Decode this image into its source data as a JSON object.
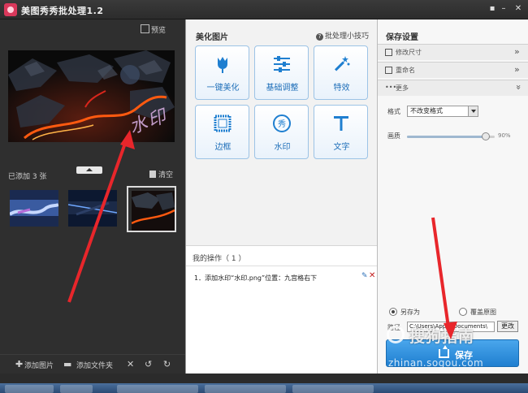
{
  "window": {
    "title": "美图秀秀批处理1.2",
    "menu_icon": "menu-icon",
    "minimize_icon": "minimize-icon",
    "close_icon": "close-icon"
  },
  "left_panel": {
    "preview_label": "预览",
    "watermark_text": "水印",
    "added_text": "已添加 3 张",
    "clear_label": "清空",
    "add_image_label": "添加图片",
    "add_folder_label": "添加文件夹",
    "delete_icon": "x-icon",
    "undo_icon": "undo-icon",
    "redo_icon": "redo-icon"
  },
  "middle_panel": {
    "title": "美化图片",
    "tips_label": "批处理小技巧",
    "tools": [
      {
        "label": "一键美化",
        "icon": "tulip-icon"
      },
      {
        "label": "基础调整",
        "icon": "sliders-icon"
      },
      {
        "label": "特效",
        "icon": "magic-wand-icon"
      },
      {
        "label": "边框",
        "icon": "frame-icon"
      },
      {
        "label": "水印",
        "icon": "watermark-icon"
      },
      {
        "label": "文字",
        "icon": "text-icon"
      }
    ],
    "ops_title": "我的操作（ 1 ）",
    "ops": [
      {
        "text": "1．添加水印“水印.png”位置：九宫格右下"
      }
    ]
  },
  "right_panel": {
    "title": "保存设置",
    "sections": [
      {
        "label": "修改尺寸",
        "icon": "crop-icon",
        "arrow": "»"
      },
      {
        "label": "重命名",
        "icon": "rename-icon",
        "arrow": "»"
      },
      {
        "label": "更多",
        "icon": "more-icon",
        "arrow": "»"
      }
    ],
    "format_label": "格式",
    "format_value": "不改变格式",
    "quality_label": "画质",
    "quality_value": "90%",
    "quality_percent": 90,
    "radio_saveas": "另存为",
    "radio_overwrite": "覆盖原图",
    "path_label": "路径",
    "path_value": "C:\\Users\\Apple\\Documents\\",
    "change_label": "更改",
    "save_label": "保存"
  },
  "overlay": {
    "logo_text": "搜狗指南",
    "logo_url": "zhinan.sogou.com"
  },
  "colors": {
    "accent": "#1f7fd0",
    "tool_text": "#1f6fb9",
    "arrow": "#e8262b"
  }
}
